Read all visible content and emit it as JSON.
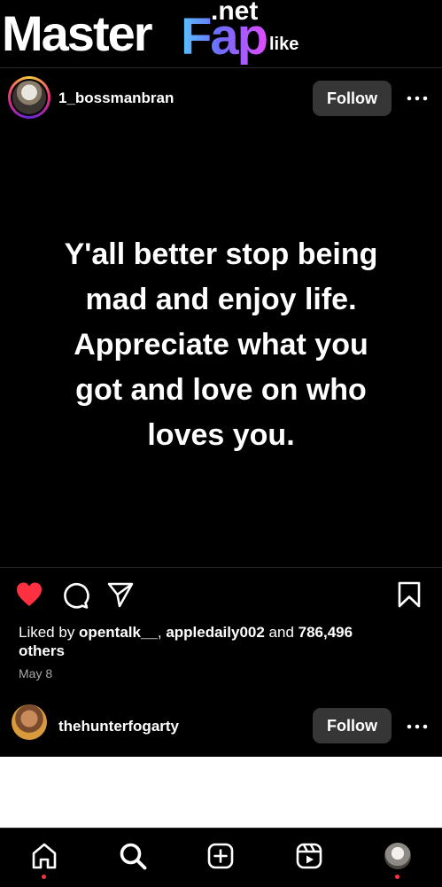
{
  "watermark": {
    "part1": "Master",
    "part2": "Fap",
    "suffix": ".net"
  },
  "topbar": {
    "visible_text": "like"
  },
  "post": {
    "username": "1_bossmanbran",
    "follow_label": "Follow",
    "image_text": "Y'all better stop being\nmad and enjoy life.\nAppreciate what you\ngot and love on who\nloves you.",
    "liked_prefix": "Liked by ",
    "liked_user1": "opentalk__",
    "liked_sep": ", ",
    "liked_user2": "appledaily002",
    "liked_and": " and ",
    "liked_count": "786,496",
    "liked_others": "others",
    "date": "May 8",
    "liked": true
  },
  "next_post": {
    "username": "thehunterfogarty",
    "follow_label": "Follow"
  },
  "nav": {
    "items": [
      "home-icon",
      "search-icon",
      "create-icon",
      "reels-icon",
      "profile-avatar"
    ],
    "active": "search"
  },
  "colors": {
    "like_red": "#ff3040",
    "follow_bg": "#363636",
    "date_gray": "#a8a8a8"
  }
}
